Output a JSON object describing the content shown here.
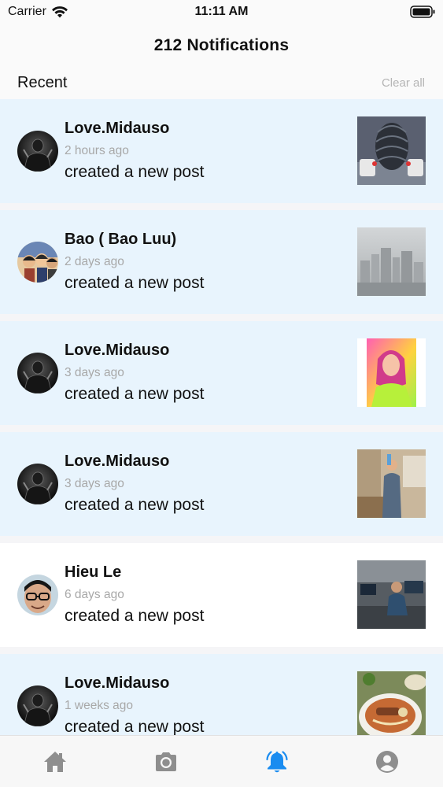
{
  "status_bar": {
    "carrier": "Carrier",
    "time": "11:11 AM"
  },
  "header": {
    "title": "212 Notifications",
    "section": "Recent",
    "clear_all": "Clear all"
  },
  "notifications": [
    {
      "name": "Love.Midauso",
      "time": "2 hours ago",
      "message": "created a new post",
      "read": false
    },
    {
      "name": "Bao ( Bao Luu)",
      "time": "2 days ago",
      "message": "created a new post",
      "read": false
    },
    {
      "name": "Love.Midauso",
      "time": "3 days ago",
      "message": "created a new post",
      "read": false
    },
    {
      "name": "Love.Midauso",
      "time": "3 days ago",
      "message": "created a new post",
      "read": false
    },
    {
      "name": "Hieu Le",
      "time": "6 days ago",
      "message": "created a new post",
      "read": true
    },
    {
      "name": "Love.Midauso",
      "time": "1 weeks ago",
      "message": "created a new post",
      "read": false
    }
  ],
  "tabs": [
    {
      "icon": "home-icon",
      "active": false
    },
    {
      "icon": "camera-icon",
      "active": false
    },
    {
      "icon": "bell-icon",
      "active": true
    },
    {
      "icon": "profile-icon",
      "active": false
    }
  ],
  "colors": {
    "accent": "#1a8cf0",
    "unread_background": "#e8f4fd",
    "inactive_tab": "#8e8e8e",
    "muted_text": "#a8a8a8"
  }
}
